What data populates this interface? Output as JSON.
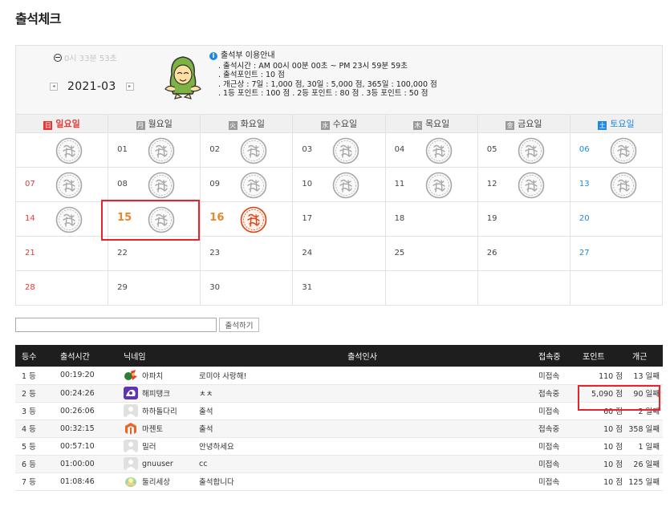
{
  "page_title": "출석체크",
  "timer": "0시 33분 53초",
  "month_nav": {
    "prev": "◂",
    "label": "2021-03",
    "next": "▸"
  },
  "notice": {
    "title": "출석부 이용안내",
    "lines": [
      ". 출석시간 : AM 00시 00분 00초 ~ PM 23시 59분 59초",
      ". 출석포인트 : 10 점",
      ". 개근상 : 7일 : 1,000 점,   30일 : 5,000 점,  365일 : 100,000 점",
      ". 1등 포인트 : 100 점   . 2등 포인트 : 80 점   . 3등 포인트 : 50 점"
    ]
  },
  "calendar": {
    "weekdays": [
      {
        "badge": "日",
        "label": "일요일",
        "color": "#e53935"
      },
      {
        "badge": "月",
        "label": "월요일",
        "color": "#999999"
      },
      {
        "badge": "火",
        "label": "화요일",
        "color": "#999999"
      },
      {
        "badge": "水",
        "label": "수요일",
        "color": "#999999"
      },
      {
        "badge": "木",
        "label": "목요일",
        "color": "#999999"
      },
      {
        "badge": "金",
        "label": "금요일",
        "color": "#999999"
      },
      {
        "badge": "土",
        "label": "토요일",
        "color": "#1e88e5"
      }
    ],
    "weeks": [
      [
        {
          "day": "",
          "stamp": "gray"
        },
        {
          "day": "01",
          "stamp": "gray"
        },
        {
          "day": "02",
          "stamp": "gray"
        },
        {
          "day": "03",
          "stamp": "gray"
        },
        {
          "day": "04",
          "stamp": "gray"
        },
        {
          "day": "05",
          "stamp": "gray"
        },
        {
          "day": "06",
          "stamp": "gray"
        }
      ],
      [
        {
          "day": "07",
          "stamp": "gray"
        },
        {
          "day": "08",
          "stamp": "gray"
        },
        {
          "day": "09",
          "stamp": "gray"
        },
        {
          "day": "10",
          "stamp": "gray"
        },
        {
          "day": "11",
          "stamp": "gray"
        },
        {
          "day": "12",
          "stamp": "gray"
        },
        {
          "day": "13",
          "stamp": "gray"
        }
      ],
      [
        {
          "day": "14",
          "stamp": "gray"
        },
        {
          "day": "15",
          "stamp": "gray",
          "emph": true
        },
        {
          "day": "16",
          "stamp": "red",
          "emph": true
        },
        {
          "day": "17",
          "stamp": ""
        },
        {
          "day": "18",
          "stamp": ""
        },
        {
          "day": "19",
          "stamp": ""
        },
        {
          "day": "20",
          "stamp": ""
        }
      ],
      [
        {
          "day": "21",
          "stamp": ""
        },
        {
          "day": "22",
          "stamp": ""
        },
        {
          "day": "23",
          "stamp": ""
        },
        {
          "day": "24",
          "stamp": ""
        },
        {
          "day": "25",
          "stamp": ""
        },
        {
          "day": "26",
          "stamp": ""
        },
        {
          "day": "27",
          "stamp": ""
        }
      ],
      [
        {
          "day": "28",
          "stamp": ""
        },
        {
          "day": "29",
          "stamp": ""
        },
        {
          "day": "30",
          "stamp": ""
        },
        {
          "day": "31",
          "stamp": ""
        },
        {
          "day": "",
          "stamp": ""
        },
        {
          "day": "",
          "stamp": ""
        },
        {
          "day": "",
          "stamp": ""
        }
      ]
    ]
  },
  "greeting": {
    "value": "",
    "button": "출석하기"
  },
  "list": {
    "headers": [
      "등수",
      "출석시간",
      "닉네임",
      "출석인사",
      "접속중",
      "포인트",
      "개근"
    ],
    "rows": [
      {
        "rank": "1 등",
        "time": "00:19:20",
        "nick": "아파치",
        "avatar": "apache",
        "greet": "로미야 사랑해!",
        "status": "미접속",
        "points": "110 점",
        "streak": "13 일째"
      },
      {
        "rank": "2 등",
        "time": "00:24:26",
        "nick": "해피탱크",
        "avatar": "purple",
        "greet": "ㅊㅊ",
        "status": "접속중",
        "points": "5,090 점",
        "streak": "90 일째"
      },
      {
        "rank": "3 등",
        "time": "00:26:06",
        "nick": "하하돌다리",
        "avatar": "default",
        "greet": "출석",
        "status": "미접속",
        "points": "60 점",
        "streak": "2 일째"
      },
      {
        "rank": "4 등",
        "time": "00:32:15",
        "nick": "마젠토",
        "avatar": "magento",
        "greet": "출석",
        "status": "접속중",
        "points": "10 점",
        "streak": "358 일째"
      },
      {
        "rank": "5 등",
        "time": "00:57:10",
        "nick": "밀러",
        "avatar": "default",
        "greet": "안녕하세요",
        "status": "미접속",
        "points": "10 점",
        "streak": "1 일째"
      },
      {
        "rank": "6 등",
        "time": "01:00:00",
        "nick": "gnuuser",
        "avatar": "default",
        "greet": "cc",
        "status": "미접속",
        "points": "10 점",
        "streak": "26 일째"
      },
      {
        "rank": "7 등",
        "time": "01:08:46",
        "nick": "둘리세상",
        "avatar": "dooly",
        "greet": "출석합니다",
        "status": "미접속",
        "points": "10 점",
        "streak": "125 일째"
      }
    ]
  }
}
